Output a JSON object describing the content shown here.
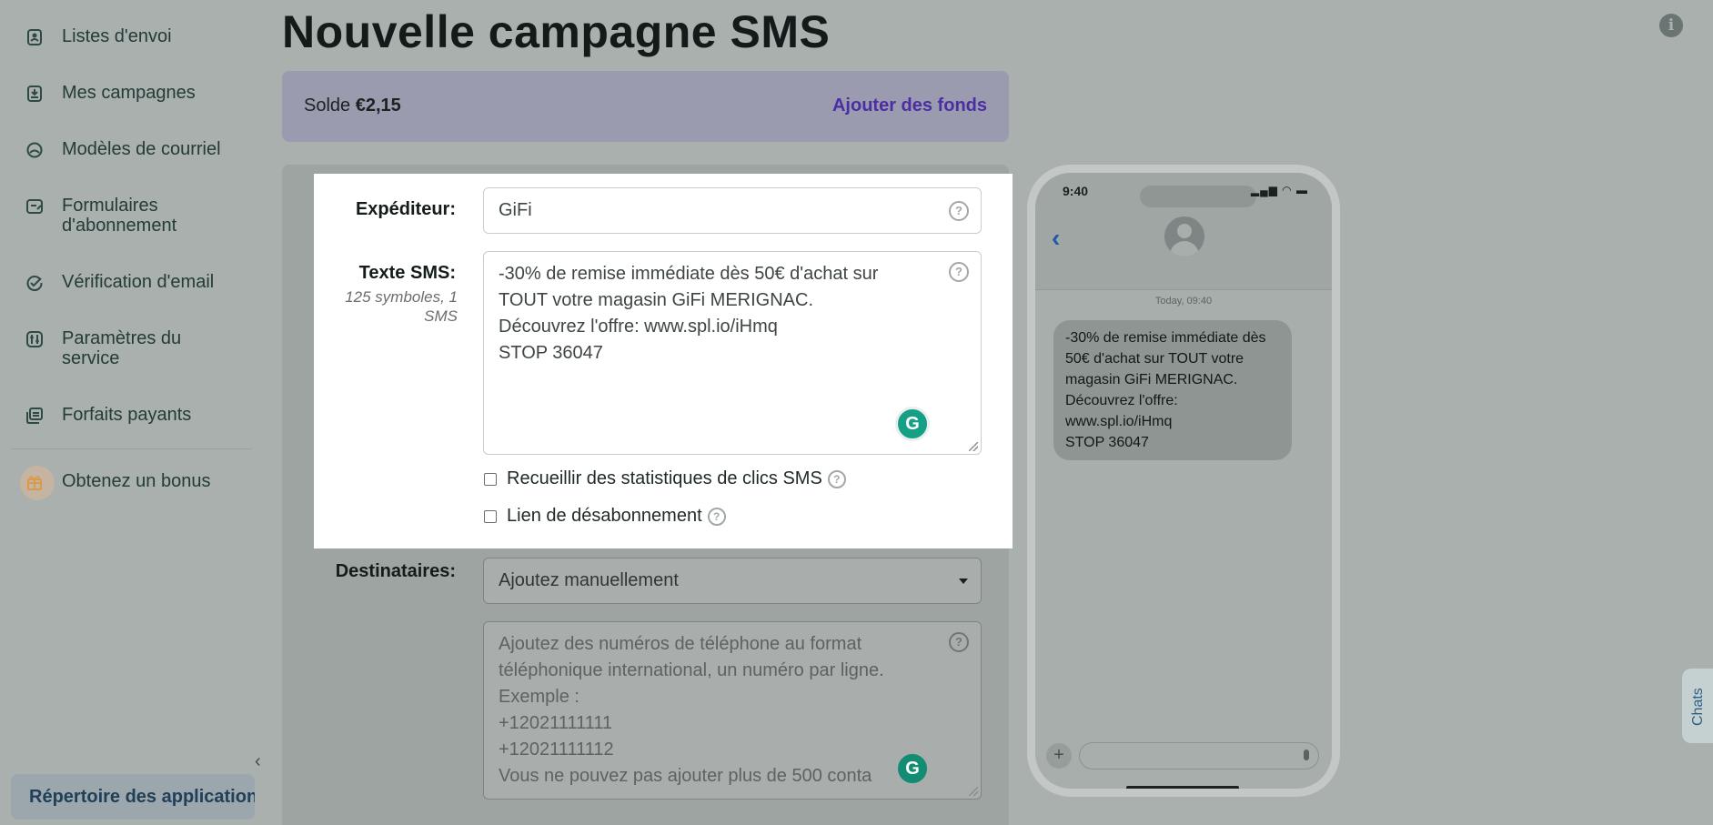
{
  "sidebar": {
    "items": [
      {
        "label": "Listes d'envoi",
        "icon": "address-book-icon"
      },
      {
        "label": "Mes campagnes",
        "icon": "campaign-icon"
      },
      {
        "label": "Modèles de courriel",
        "icon": "email-template-icon"
      },
      {
        "label": "Formulaires d'abonnement",
        "icon": "form-icon"
      },
      {
        "label": "Vérification d'email",
        "icon": "check-circle-icon"
      },
      {
        "label": "Paramètres du service",
        "icon": "settings-sliders-icon"
      },
      {
        "label": "Forfaits payants",
        "icon": "plans-stack-icon"
      },
      {
        "label": "Obtenez un bonus",
        "icon": "gift-icon"
      }
    ],
    "app_directory": "Répertoire des applications",
    "collapse_glyph": "‹"
  },
  "page": {
    "title": "Nouvelle campagne SMS",
    "info_glyph": "i"
  },
  "balance": {
    "label": "Solde",
    "amount": "€2,15",
    "add_funds": "Ajouter des fonds"
  },
  "form": {
    "sender": {
      "label": "Expéditeur:",
      "value": "GiFi"
    },
    "sms_text": {
      "label": "Texte SMS:",
      "counter": "125 symboles, 1 SMS",
      "value": "-30% de remise immédiate dès 50€ d'achat sur\nTOUT votre magasin GiFi MERIGNAC.\nDécouvrez l'offre: www.spl.io/iHmq\nSTOP 36047"
    },
    "collect_stats": {
      "label": "Recueillir des statistiques de clics SMS",
      "checked": false
    },
    "unsubscribe_link": {
      "label": "Lien de désabonnement",
      "checked": false
    },
    "recipients": {
      "label": "Destinataires:",
      "selected": "Ajoutez manuellement",
      "placeholder": "Ajoutez des numéros de téléphone au format\ntéléphonique international, un numéro par ligne.\nExemple :\n+12021111111\n+12021111112\nVous ne pouvez pas ajouter plus de 500 conta"
    },
    "help_glyph": "?",
    "grammarly_glyph": "G"
  },
  "phone_preview": {
    "time": "9:40",
    "status": "▂▄▆ ◠ ▬",
    "back_glyph": "‹",
    "message_date": "Today, 09:40",
    "message": "-30% de remise immédiate dès\n50€ d'achat sur TOUT votre\nmagasin GiFi MERIGNAC.\nDécouvrez l'offre:\nwww.spl.io/iHmq\nSTOP 36047",
    "plus_glyph": "+"
  },
  "chats_tab": {
    "label": "Chats"
  },
  "colors": {
    "accent": "#4c2ea3",
    "grammarly": "#15a085",
    "link_blue": "#2457a8"
  }
}
